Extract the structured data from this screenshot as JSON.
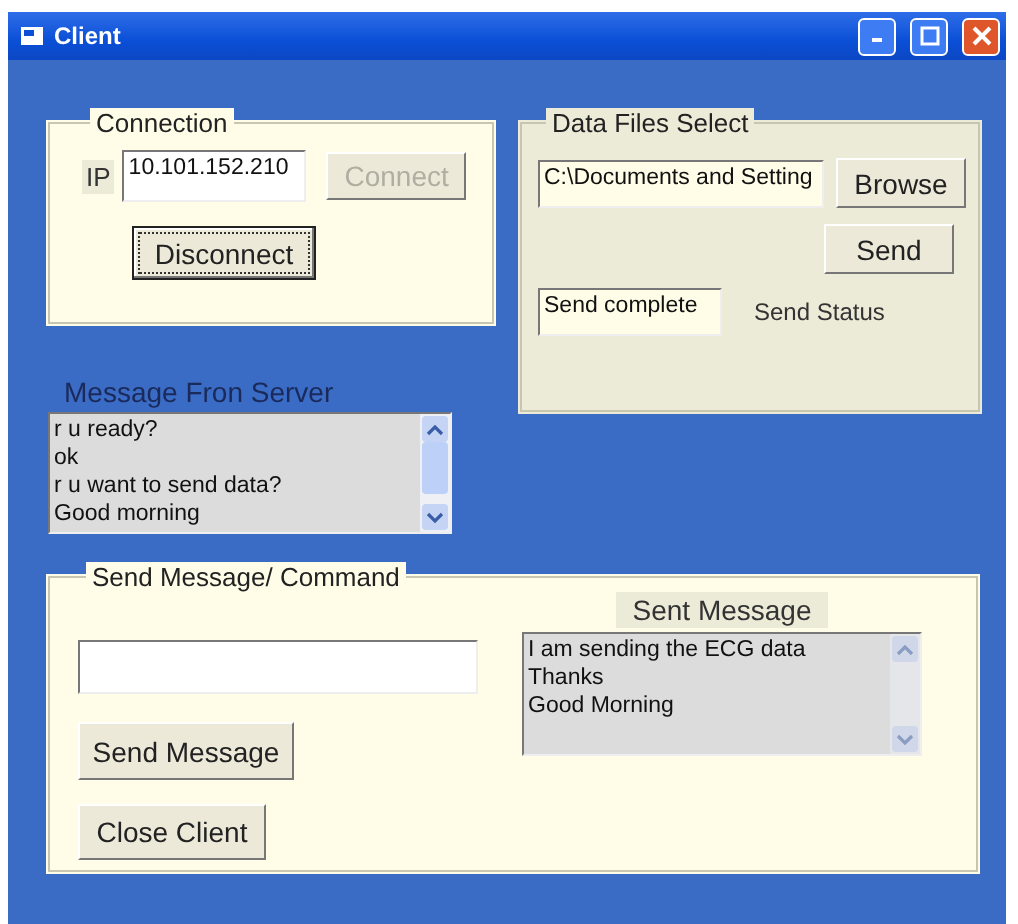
{
  "window": {
    "title": "Client"
  },
  "connection": {
    "title": "Connection",
    "ip_label": "IP",
    "ip_value": "10.101.152.210",
    "buttons": [
      {
        "label": "Connect",
        "disabled": true,
        "focused": false
      },
      {
        "label": "Disconnect",
        "disabled": false,
        "focused": true
      }
    ]
  },
  "data_files": {
    "title": "Data Files Select",
    "path": "C:\\Documents and Setting",
    "browse": "Browse",
    "send": "Send",
    "status_value": "Send complete",
    "status_label": "Send Status"
  },
  "server_messages": {
    "title": "Message Fron Server",
    "lines": [
      "r u ready?",
      "ok",
      "r u want to send data?",
      "Good morning"
    ]
  },
  "send_panel": {
    "title": "Send Message/ Command",
    "send_button": "Send Message",
    "close_button": "Close Client",
    "sent_title": "Sent Message",
    "sent_lines": [
      "I am sending the ECG data",
      "Thanks",
      "Good Morning"
    ]
  }
}
